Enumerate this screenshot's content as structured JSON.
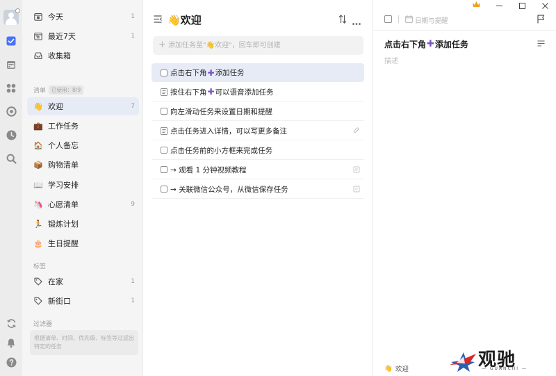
{
  "colors": {
    "accent": "#4772fa",
    "selected_bg": "#e6ebf6",
    "purple_plus": "#7a52c7"
  },
  "sidebar": {
    "smart_lists": [
      {
        "icon": "calendar-today-icon",
        "label": "今天",
        "count": "1"
      },
      {
        "icon": "calendar-week-icon",
        "label": "最近7天",
        "count": "1"
      },
      {
        "icon": "inbox-icon",
        "label": "收集箱",
        "count": ""
      }
    ],
    "lists_header": "清单",
    "lists_usage": "已使用：8/9",
    "lists": [
      {
        "emoji": "👋",
        "icon": "waving-hand-icon",
        "label": "欢迎",
        "count": "7"
      },
      {
        "emoji": "💼",
        "icon": "briefcase-icon",
        "label": "工作任务",
        "count": ""
      },
      {
        "emoji": "🏠",
        "icon": "house-icon",
        "label": "个人备忘",
        "count": ""
      },
      {
        "emoji": "📦",
        "icon": "package-icon",
        "label": "购物清单",
        "count": ""
      },
      {
        "emoji": "📖",
        "icon": "book-icon",
        "label": "学习安排",
        "count": ""
      },
      {
        "emoji": "🦄",
        "icon": "unicorn-icon",
        "label": "心愿清单",
        "count": "9"
      },
      {
        "emoji": "🏃",
        "icon": "runner-icon",
        "label": "锻炼计划",
        "count": ""
      },
      {
        "emoji": "🎂",
        "icon": "cake-icon",
        "label": "生日提醒",
        "count": ""
      }
    ],
    "tags_header": "标签",
    "tags": [
      {
        "label": "在家",
        "count": "1"
      },
      {
        "label": "新街口",
        "count": "1"
      }
    ],
    "filters_header": "过滤器",
    "filters_hint": "根据清单、时间、优先级、标签等过滤出特定的任务"
  },
  "list": {
    "title": "欢迎",
    "title_emoji": "👋",
    "add_placeholder": "添加任务至\"👋欢迎\"，回车即可创建",
    "tasks": [
      {
        "pre": "点击右下角",
        "post": "添加任务",
        "purple": true,
        "kind": "checkbox",
        "trail": ""
      },
      {
        "pre": "按住右下角",
        "post": "可以语音添加任务",
        "purple": true,
        "kind": "note",
        "trail": ""
      },
      {
        "pre": "向左滑动任务来设置日期和提醒",
        "post": "",
        "purple": false,
        "kind": "checkbox",
        "trail": ""
      },
      {
        "pre": "点击任务进入详情，可以写更多备注",
        "post": "",
        "purple": false,
        "kind": "note",
        "trail": "attachment-icon"
      },
      {
        "pre": "点击任务前的小方框来完成任务",
        "post": "",
        "purple": false,
        "kind": "checkbox",
        "trail": ""
      },
      {
        "pre": "→ 观看 1 分钟视频教程",
        "post": "",
        "purple": false,
        "kind": "checkbox",
        "trail": "note-icon"
      },
      {
        "pre": "→ 关联微信公众号，从微信保存任务",
        "post": "",
        "purple": false,
        "kind": "checkbox",
        "trail": "note-icon"
      }
    ]
  },
  "detail": {
    "date_placeholder": "日期与提醒",
    "title_pre": "点击右下角",
    "title_post": "添加任务",
    "description_placeholder": "描述",
    "footer_list": "欢迎",
    "footer_emoji": "👋"
  },
  "watermark": {
    "text": "观驰",
    "sub": "— GUANCHI —"
  }
}
